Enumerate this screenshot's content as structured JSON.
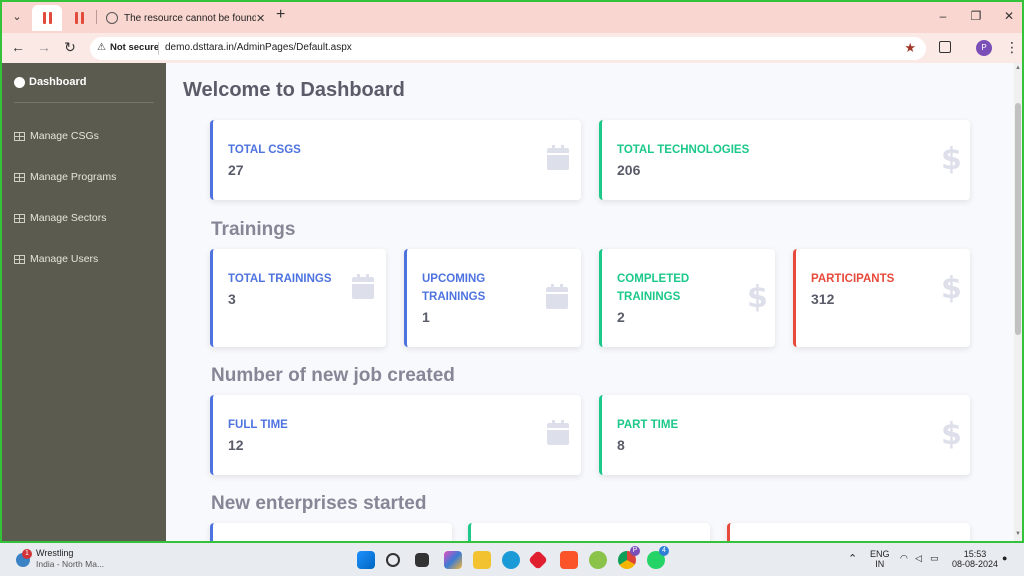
{
  "browser": {
    "tab_title": "The resource cannot be found.",
    "tab_close": "✕",
    "new_tab": "+",
    "security_label": "Not secure",
    "url": "demo.dsttara.in/AdminPages/Default.aspx",
    "profile_initial": "P",
    "window_controls": [
      "–",
      "❐",
      "✕"
    ]
  },
  "sidebar": {
    "dashboard": "Dashboard",
    "items": [
      {
        "label": "Manage CSGs"
      },
      {
        "label": "Manage Programs"
      },
      {
        "label": "Manage Sectors"
      },
      {
        "label": "Manage Users"
      }
    ]
  },
  "page": {
    "title": "Welcome to Dashboard",
    "top_cards": [
      {
        "label": "TOTAL CSGS",
        "value": "27",
        "icon": "calendar-icon",
        "color": "#4e73df"
      },
      {
        "label": "TOTAL TECHNOLOGIES",
        "value": "206",
        "icon": "dollar-icon",
        "color": "#1cc88a"
      }
    ],
    "trainings_title": "Trainings",
    "training_cards": [
      {
        "label": "TOTAL TRAININGS",
        "value": "3",
        "icon": "calendar-icon",
        "color": "#4e73df"
      },
      {
        "label": "UPCOMING TRAININGS",
        "value": "1",
        "icon": "calendar-icon",
        "color": "#4e73df"
      },
      {
        "label": "COMPLETED TRAININGS",
        "value": "2",
        "icon": "dollar-icon",
        "color": "#1cc88a"
      },
      {
        "label": "PARTICIPANTS",
        "value": "312",
        "icon": "dollar-icon",
        "color": "#e74a3b"
      }
    ],
    "jobs_title": "Number of new job created",
    "job_cards": [
      {
        "label": "FULL TIME",
        "value": "12",
        "icon": "calendar-icon",
        "color": "#4e73df"
      },
      {
        "label": "PART TIME",
        "value": "8",
        "icon": "dollar-icon",
        "color": "#1cc88a"
      }
    ],
    "enterprises_title": "New enterprises started"
  },
  "taskbar": {
    "weather_badge": "1",
    "weather_title": "Wrestling",
    "weather_subtitle": "India - North Ma...",
    "profile_badge": "P",
    "whatsapp_badge": "4",
    "lang_line1": "ENG",
    "lang_line2": "IN",
    "time": "15:53",
    "date": "08-08-2024"
  }
}
